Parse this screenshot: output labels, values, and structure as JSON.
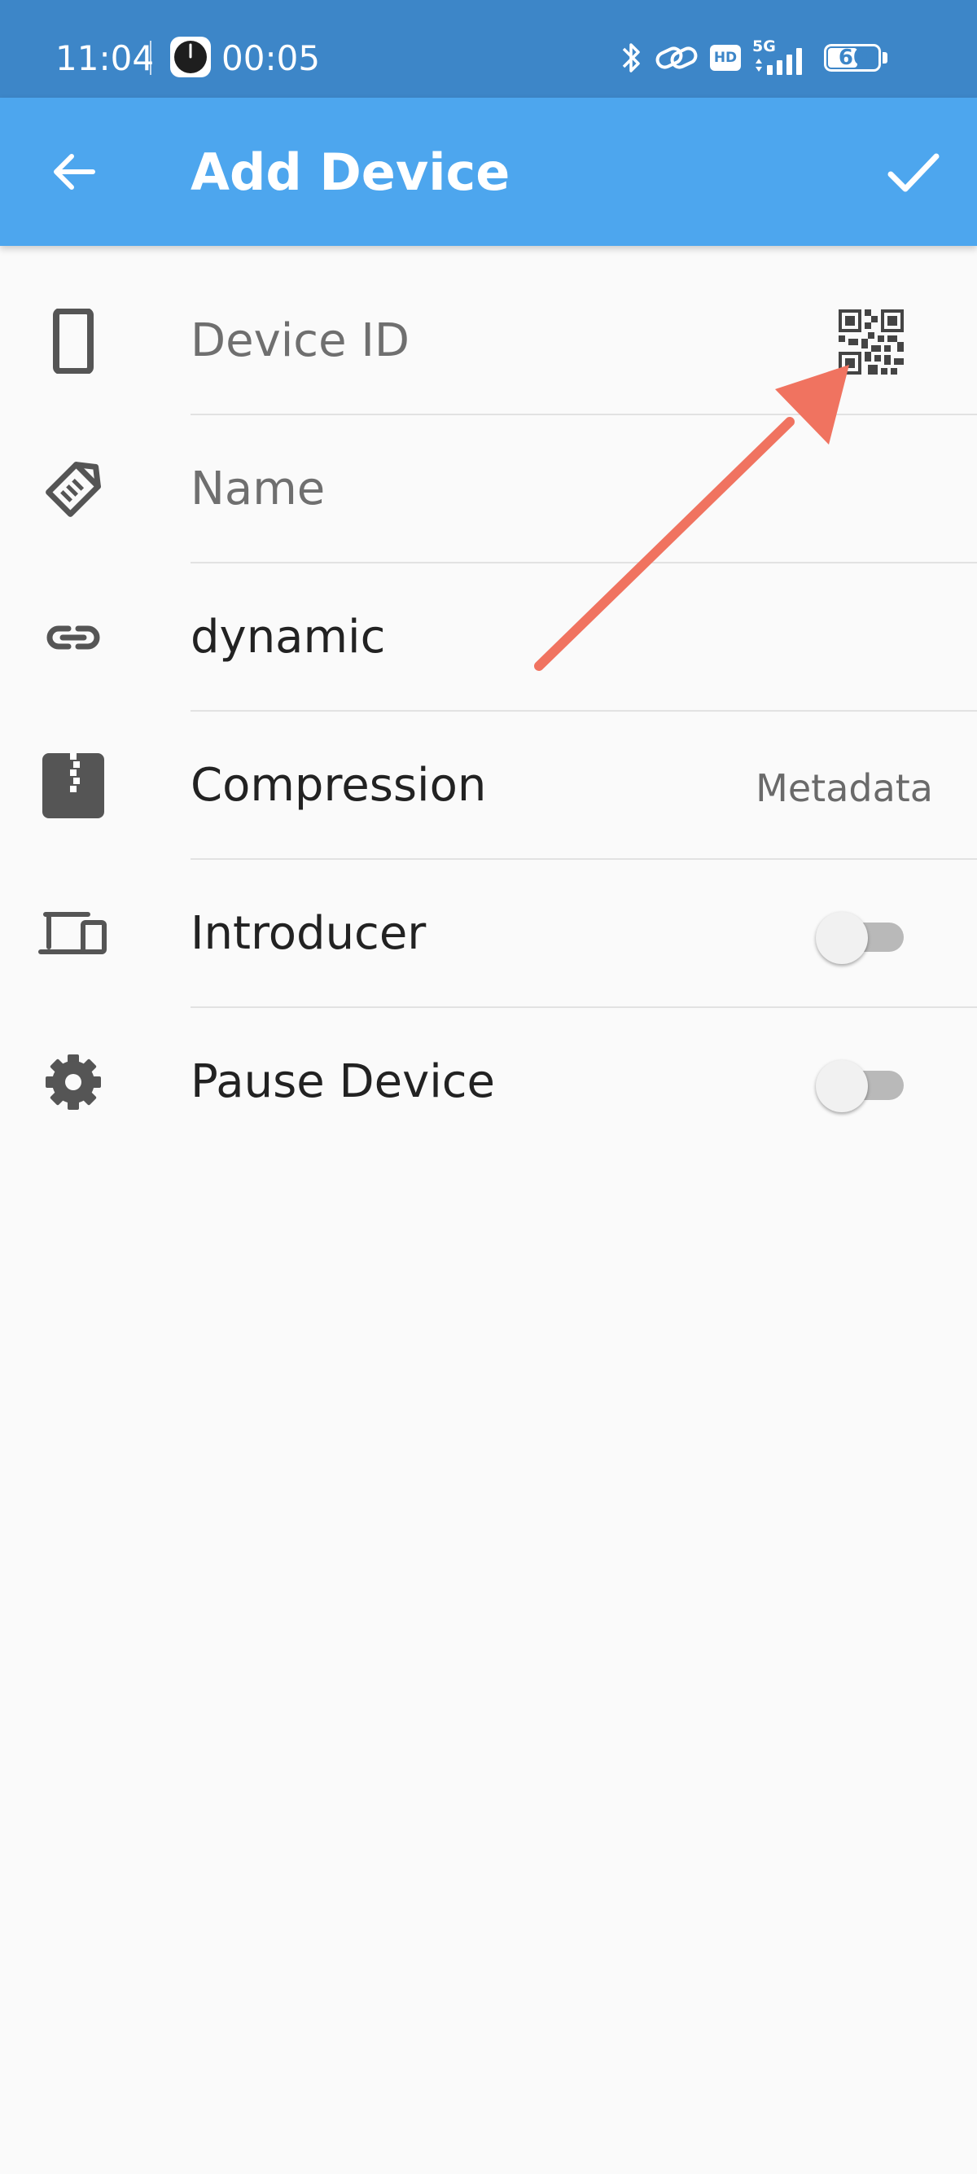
{
  "status_bar": {
    "time": "11:04",
    "timer": "00:05",
    "network": "5G",
    "hd_badge": "HD",
    "battery": "60",
    "icons": [
      "clock-icon",
      "bluetooth-icon",
      "link-icon",
      "hd-icon",
      "signal-icon",
      "battery-icon"
    ]
  },
  "app_bar": {
    "title": "Add Device",
    "back_icon": "arrow-back-icon",
    "done_icon": "check-icon",
    "color": "#4da6ee"
  },
  "rows": {
    "device_id": {
      "placeholder": "Device ID",
      "icon": "phone-icon",
      "action_icon": "qr-code-icon"
    },
    "name": {
      "placeholder": "Name",
      "icon": "tag-icon"
    },
    "address": {
      "value": "dynamic",
      "icon": "link-icon"
    },
    "compression": {
      "label": "Compression",
      "value": "Metadata",
      "icon": "zip-icon"
    },
    "introducer": {
      "label": "Introducer",
      "checked": false,
      "icon": "devices-icon"
    },
    "pause_device": {
      "label": "Pause Device",
      "checked": false,
      "icon": "gear-icon"
    }
  },
  "annotation": {
    "type": "arrow",
    "color": "#f07360",
    "target": "qr-code-icon"
  }
}
